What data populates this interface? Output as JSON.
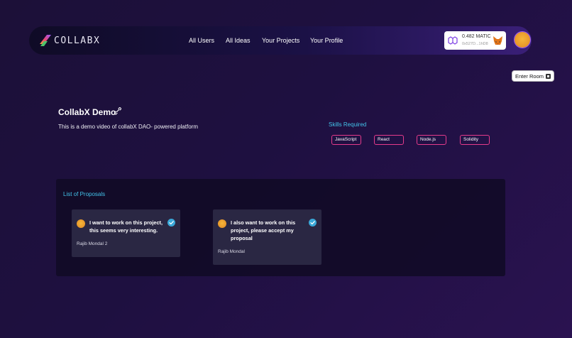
{
  "navbar": {
    "brand": "COLLABX",
    "links": [
      "All Users",
      "All Ideas",
      "Your Projects",
      "Your Profile"
    ],
    "wallet": {
      "balance": "0.482 MATIC",
      "address": "0x527D...1hD8"
    }
  },
  "room": {
    "enter_label": "Enter Room"
  },
  "project": {
    "title": "CollabX Demo",
    "description": "This is a demo video of collabX DAO- powered platform",
    "skills_label": "Skills Required",
    "skills": [
      "JavaScript",
      "React",
      "Node.js",
      "Solidity"
    ]
  },
  "proposals": {
    "label": "List of Proposals",
    "items": [
      {
        "message_lines": [
          "I want to work on this project,",
          "this seems very interesting."
        ],
        "author": "Rajib Mondal 2"
      },
      {
        "message_lines": [
          "I also want to work on this",
          "project, please accept my",
          "proposal"
        ],
        "author": "Rajib Mondal"
      }
    ]
  },
  "colors": {
    "accent_cyan": "#43c3ea",
    "skill_border": "#e63b8b",
    "check_blue": "#3aa8d8"
  }
}
